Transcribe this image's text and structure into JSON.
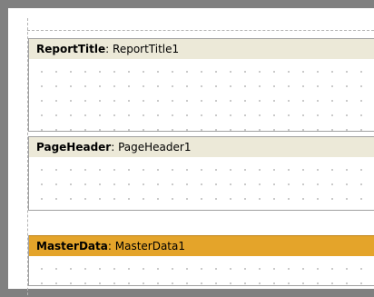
{
  "bands": {
    "report_title": {
      "type_label": "ReportTitle",
      "separator": ": ",
      "instance_name": "ReportTitle1"
    },
    "page_header": {
      "type_label": "PageHeader",
      "separator": ": ",
      "instance_name": "PageHeader1"
    },
    "master_data": {
      "type_label": "MasterData",
      "separator": ": ",
      "instance_name": "MasterData1"
    }
  },
  "colors": {
    "workspace_frame": "#808080",
    "band_header_light": "#ece9d8",
    "band_header_selected": "#e4a42a",
    "grid_dot": "#9a9a9a"
  }
}
